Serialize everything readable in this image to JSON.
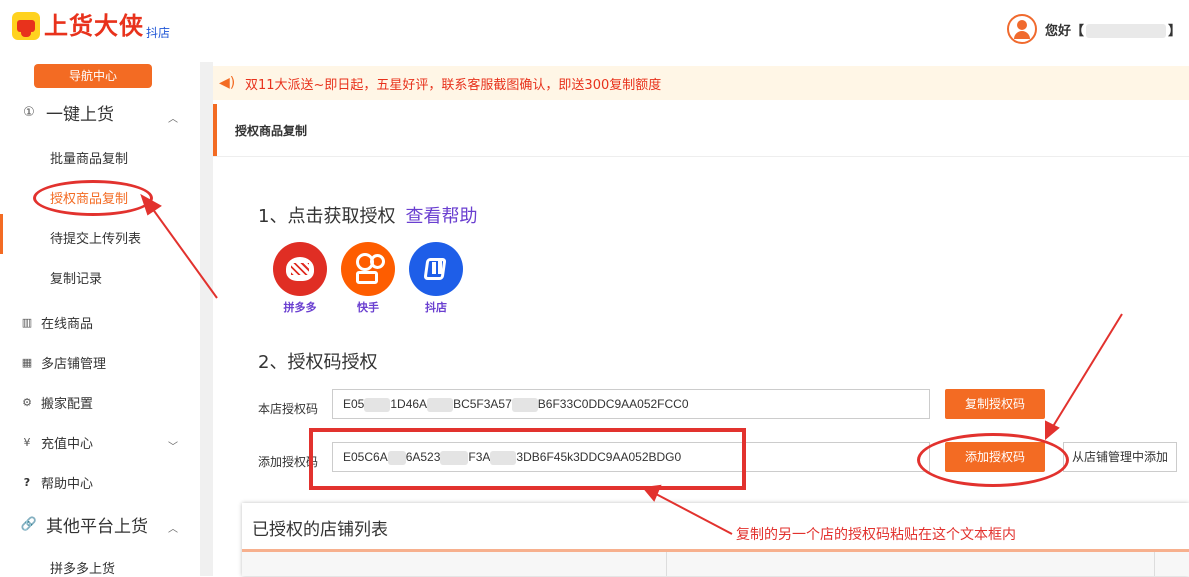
{
  "header": {
    "logo_text": "上货大侠",
    "logo_sub": "抖店",
    "greeting": "您好【",
    "greeting_end": "】"
  },
  "sidebar": {
    "nav_center": "导航中心",
    "group1": {
      "label": "一键上货",
      "icon": "upload-icon",
      "chevron": "^"
    },
    "group1_items": [
      "批量商品复制",
      "授权商品复制",
      "待提交上传列表",
      "复制记录"
    ],
    "plain_items": [
      {
        "label": "在线商品",
        "icon": "list-icon"
      },
      {
        "label": "多店铺管理",
        "icon": "grid-icon"
      },
      {
        "label": "搬家配置",
        "icon": "gear-icon"
      },
      {
        "label": "充值中心",
        "icon": "yen-icon",
        "chevron": "v"
      },
      {
        "label": "帮助中心",
        "icon": "question-icon"
      }
    ],
    "group2": {
      "label": "其他平台上货",
      "icon": "link-icon",
      "chevron": "^"
    },
    "group2_items": [
      "拼多多上货"
    ]
  },
  "notice": {
    "text": "双11大派送~即日起，五星好评，联系客服截图确认，即送300复制额度"
  },
  "section": {
    "title": "授权商品复制"
  },
  "step1": {
    "title": "1、点击获取授权",
    "help_link": "查看帮助",
    "platforms": [
      {
        "name": "拼多多",
        "color": "#e02e24"
      },
      {
        "name": "快手",
        "color": "#fe5d00"
      },
      {
        "name": "抖店",
        "color": "#1e5ee8"
      }
    ]
  },
  "step2": {
    "title": "2、授权码授权",
    "own_label": "本店授权码",
    "own_code_parts": [
      "E05",
      "1D46A",
      "BC5F3A57",
      "B6F33C0DDC9AA052FCC0"
    ],
    "copy_button": "复制授权码",
    "add_label": "添加授权码",
    "add_code_parts": [
      "E05C6A",
      "6A523",
      "F3A",
      "3DB6F45k3DDC9AA052BDG0"
    ],
    "add_button": "添加授权码",
    "from_manage_button": "从店铺管理中添加"
  },
  "authorized": {
    "title": "已授权的店铺列表"
  },
  "annotation": {
    "text": "复制的另一个店的授权码粘贴在这个文本框内",
    "color": "#e2322e"
  },
  "colors": {
    "accent": "#f36b23",
    "link": "#6a3fd0"
  }
}
